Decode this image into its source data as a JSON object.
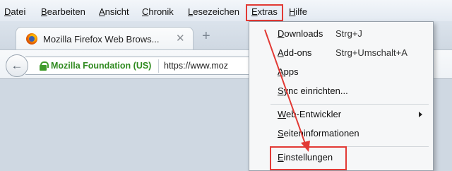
{
  "menubar": {
    "items": [
      {
        "label": "Datei"
      },
      {
        "label": "Bearbeiten"
      },
      {
        "label": "Ansicht"
      },
      {
        "label": "Chronik"
      },
      {
        "label": "Lesezeichen"
      },
      {
        "label": "Extras"
      },
      {
        "label": "Hilfe"
      }
    ]
  },
  "tab": {
    "title": "Mozilla Firefox Web Brows...",
    "close_glyph": "✕",
    "favicon": "firefox-icon"
  },
  "newtab": {
    "glyph": "+"
  },
  "navbar": {
    "back_glyph": "←",
    "identity": "Mozilla Foundation (US)",
    "url": "https://www.moz"
  },
  "dropdown": {
    "items": [
      {
        "label": "Downloads",
        "shortcut": "Strg+J"
      },
      {
        "label": "Add-ons",
        "shortcut": "Strg+Umschalt+A"
      },
      {
        "label": "Apps",
        "shortcut": ""
      },
      {
        "label": "Sync einrichten...",
        "shortcut": ""
      },
      {
        "label": "Web-Entwickler",
        "shortcut": "",
        "submenu": true
      },
      {
        "label": "Seiteninformationen",
        "shortcut": ""
      },
      {
        "label": "Einstellungen",
        "shortcut": ""
      }
    ]
  },
  "colors": {
    "highlight": "#e23a35",
    "secure_green": "#3f9b2b"
  }
}
